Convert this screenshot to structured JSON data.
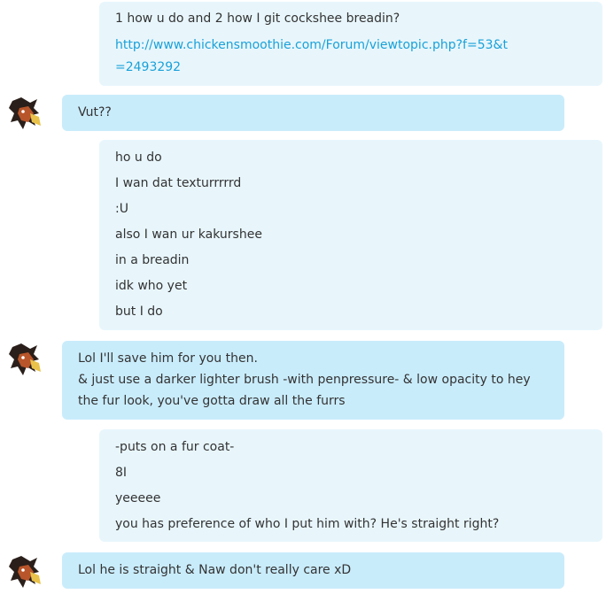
{
  "messages": [
    {
      "from": "self",
      "lines": [
        "1 how u do and 2 how I git cockshee breadin?"
      ],
      "link_lines": [
        "http://www.chickensmoothie.com/Forum/viewtopic.php?f=53&t",
        "=2493292"
      ]
    },
    {
      "from": "contact",
      "lines": [
        "Vut??"
      ]
    },
    {
      "from": "self",
      "lines": [
        "ho u do",
        "I wan dat texturrrrrd",
        ":U",
        "also I wan ur kakurshee",
        "in a breadin",
        "idk who yet",
        "but I do"
      ]
    },
    {
      "from": "contact",
      "lines": [
        "Lol I'll save him for you then.",
        "& just use a darker lighter brush -with penpressure- & low opacity to hey",
        "the fur look, you've gotta draw all the furrs"
      ]
    },
    {
      "from": "self",
      "lines": [
        "-puts on a fur coat-",
        "8I",
        "yeeeee",
        "you has preference of who I put him with? He's straight right?"
      ]
    },
    {
      "from": "contact",
      "lines": [
        "Lol he is straight & Naw don't really care xD"
      ]
    }
  ],
  "colors": {
    "self_bubble": "#e8f6fc",
    "contact_bubble": "#c9ecfb",
    "link": "#1aa1d8",
    "text": "#333333"
  },
  "avatar_icon": "furry-character-avatar-icon"
}
